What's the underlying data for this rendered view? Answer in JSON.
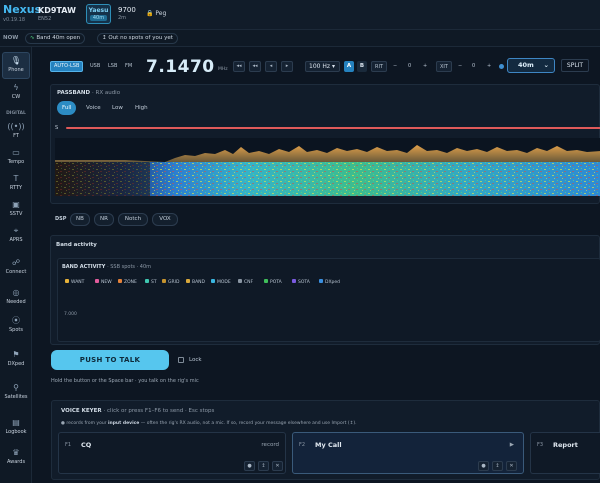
{
  "app": {
    "name": "Nexus",
    "version": "v0.19.18"
  },
  "station": {
    "callsign": "KD9TAW",
    "grid": "EN52"
  },
  "radio": {
    "name": "Yaesu",
    "band": "40m"
  },
  "frequency_chip": {
    "value": "9700",
    "unit": "2m"
  },
  "peg": {
    "label": "Peg"
  },
  "now": {
    "label": "NOW",
    "band_open": "Band 40m open",
    "out_status": "Out  no spots of you yet"
  },
  "sidebar": {
    "items_top": [
      {
        "label": "Phone",
        "icon": "microphone-icon"
      },
      {
        "label": "CW",
        "icon": "bolt-icon"
      }
    ],
    "digital_header": "DIGITAL",
    "items_digital": [
      {
        "label": "FT",
        "icon": "signal-icon"
      },
      {
        "label": "Tempo",
        "icon": "chat-icon"
      },
      {
        "label": "RTTY",
        "icon": "teletype-icon"
      },
      {
        "label": "SSTV",
        "icon": "image-icon"
      },
      {
        "label": "APRS",
        "icon": "pin-icon"
      },
      {
        "label": "Connect",
        "icon": "connect-icon"
      },
      {
        "label": "Needed",
        "icon": "target-icon"
      },
      {
        "label": "Spots",
        "icon": "radar-icon"
      },
      {
        "label": "DXped",
        "icon": "flag-icon"
      },
      {
        "label": "Satellites",
        "icon": "satellite-icon"
      },
      {
        "label": "Logbook",
        "icon": "book-icon"
      },
      {
        "label": "Awards",
        "icon": "trophy-icon"
      }
    ]
  },
  "modebar": {
    "modes": [
      "AUTO-LSB",
      "USB",
      "LSB",
      "FM"
    ],
    "active_mode": "AUTO-LSB",
    "frequency": "7.1470",
    "freq_unit": "MHz",
    "nudge_buttons": [
      "◂◂",
      "◂◂",
      "◂",
      "▸"
    ],
    "step": "100 Hz",
    "vfo_a": "A",
    "vfo_b": "B",
    "rit_label": "RIT",
    "rit_minus": "−",
    "rit_value": "0",
    "rit_plus": "+",
    "xit_label": "XIT",
    "xit_minus": "−",
    "xit_value": "0",
    "xit_plus": "+",
    "band": "40m",
    "split": "SPLIT"
  },
  "passband": {
    "title": "PASSBAND",
    "subtitle": "· RX audio",
    "tabs": [
      "Full",
      "Voice",
      "Low",
      "High"
    ],
    "active_tab": "Full",
    "s_label": "S"
  },
  "dsp": {
    "label": "DSP",
    "buttons": [
      "NB",
      "NR",
      "Notch",
      "VOX"
    ]
  },
  "band_activity": {
    "title": "Band activity",
    "inner_title": "BAND ACTIVITY",
    "inner_sub": "· SSB spots · 40m",
    "legend": [
      {
        "label": "WANT",
        "color": "#e6b23a"
      },
      {
        "label": "NEW",
        "color": "#e25c9c"
      },
      {
        "label": "ZONE",
        "color": "#e5823a"
      },
      {
        "label": "ST",
        "color": "#3fc7b0"
      },
      {
        "label": "GRID",
        "color": "#c5932e"
      },
      {
        "label": "BAND",
        "color": "#d9a83b"
      },
      {
        "label": "MODE",
        "color": "#3ab6e0"
      },
      {
        "label": "CNF",
        "color": "#8a96a3"
      },
      {
        "label": "POTA",
        "color": "#3fbf5a"
      },
      {
        "label": "SOTA",
        "color": "#7a5ae0"
      },
      {
        "label": "DXped",
        "color": "#3a8fe0"
      }
    ],
    "freq_tick": "7.000"
  },
  "ptt": {
    "button": "PUSH TO TALK",
    "lock_label": "Lock",
    "help": "Hold the button or the Space bar · you talk on the rig's mic"
  },
  "keyer": {
    "title": "VOICE KEYER",
    "subtitle": "· click or press F1–F6 to send · Esc stops",
    "desc_prefix": "● records from your ",
    "desc_bold": "input device",
    "desc_suffix": " — often the rig's RX audio, not a mic. If so, record your message elsewhere and use Import (↥).",
    "slots": [
      {
        "key": "F1",
        "name": "CQ",
        "right": "record"
      },
      {
        "key": "F2",
        "name": "My Call",
        "right": "▶"
      },
      {
        "key": "F3",
        "name": "Report",
        "right": ""
      }
    ],
    "controls": [
      "●",
      "↥",
      "✕"
    ]
  },
  "colors": {
    "accent": "#2c8cc4",
    "ptt": "#56c6ee",
    "spectrum_line": "#e05a5a",
    "good": "#4fcf7e"
  }
}
